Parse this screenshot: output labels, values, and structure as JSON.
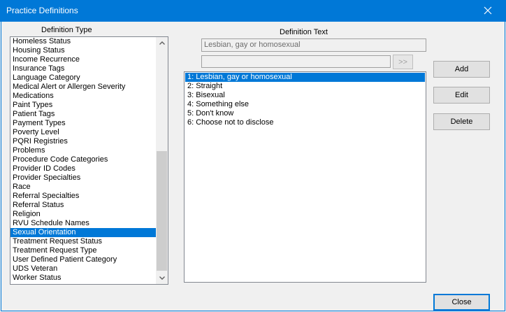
{
  "window": {
    "title": "Practice Definitions"
  },
  "definition_type": {
    "label": "Definition Type",
    "items": [
      "Homeless Status",
      "Housing Status",
      "Income Recurrence",
      "Insurance Tags",
      "Language Category",
      "Medical Alert or Allergen Severity",
      "Medications",
      "Paint Types",
      "Patient Tags",
      "Payment Types",
      "Poverty Level",
      "PQRI Registries",
      "Problems",
      "Procedure Code Categories",
      "Provider ID Codes",
      "Provider Specialties",
      "Race",
      "Referral Specialties",
      "Referral Status",
      "Religion",
      "RVU Schedule Names",
      "Sexual Orientation",
      "Treatment Request Status",
      "Treatment Request Type",
      "User Defined Patient Category",
      "UDS Veteran",
      "Worker Status"
    ],
    "selected": "Sexual Orientation"
  },
  "definition_text": {
    "label": "Definition Text",
    "value": "Lesbian, gay or homosexual",
    "second_value": "",
    "move_button": ">>"
  },
  "definitions": {
    "items": [
      "1: Lesbian, gay or homosexual",
      "2: Straight",
      "3: Bisexual",
      "4: Something else",
      "5: Don't know",
      "6: Choose not to disclose"
    ],
    "selected": "1: Lesbian, gay or homosexual"
  },
  "buttons": {
    "add": "Add",
    "edit": "Edit",
    "delete": "Delete",
    "close": "Close"
  },
  "colors": {
    "accent": "#0078d7"
  }
}
